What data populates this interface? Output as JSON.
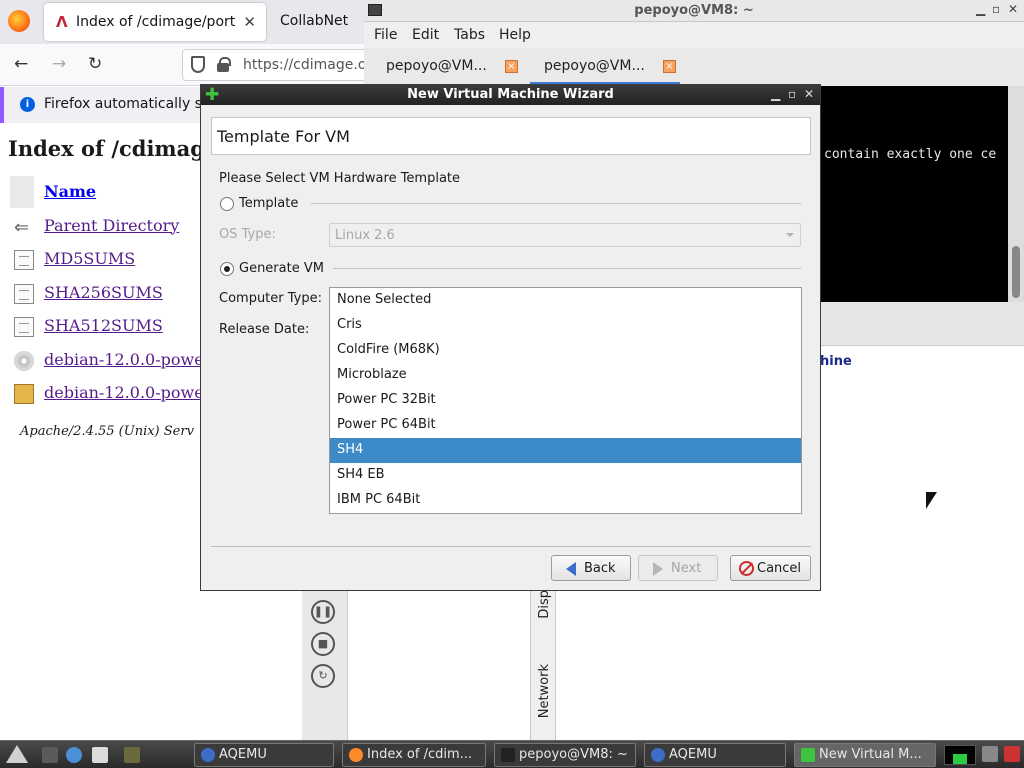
{
  "firefox": {
    "tabs": [
      {
        "label": "Index of /cdimage/ports/",
        "active": true
      },
      {
        "label": "CollabNet",
        "active": false
      }
    ],
    "url": "https://cdimage.o",
    "notice": "Firefox automatically se",
    "page_title": "Index of /cdimag",
    "listing": {
      "header": "Name",
      "rows": [
        {
          "icon": "back-icon",
          "label": "Parent Directory"
        },
        {
          "icon": "file-icon",
          "label": "MD5SUMS"
        },
        {
          "icon": "file-icon",
          "label": "SHA256SUMS"
        },
        {
          "icon": "file-icon",
          "label": "SHA512SUMS"
        },
        {
          "icon": "disc-icon",
          "label": "debian-12.0.0-powe"
        },
        {
          "icon": "package-icon",
          "label": "debian-12.0.0-powe"
        }
      ]
    },
    "server_signature": "Apache/2.4.55 (Unix) Serv"
  },
  "terminal": {
    "title": "pepoyo@VM8: ~",
    "menu": [
      "File",
      "Edit",
      "Tabs",
      "Help"
    ],
    "tabs": [
      "pepoyo@VM...",
      "pepoyo@VM..."
    ],
    "output_line": "contain exactly one ce"
  },
  "aqemu": {
    "hint": "hine",
    "side_tabs": [
      "Disp",
      "Network"
    ]
  },
  "dialog": {
    "title": "New Virtual Machine Wizard",
    "header": "Template For VM",
    "prompt": "Please Select VM Hardware Template",
    "template_radio": "Template",
    "os_type_label": "OS Type:",
    "os_type_value": "Linux 2.6",
    "generate_radio": "Generate VM",
    "computer_type_label": "Computer Type:",
    "release_date_label": "Release Date:",
    "computer_types": [
      "None Selected",
      "Cris",
      "ColdFire (M68K)",
      "Microblaze",
      "Power PC 32Bit",
      "Power PC 64Bit",
      "SH4",
      "SH4 EB",
      "IBM PC 64Bit"
    ],
    "selected_type": "SH4",
    "buttons": {
      "back": "Back",
      "next": "Next",
      "cancel": "Cancel"
    }
  },
  "taskbar": {
    "tasks": [
      {
        "label": "AQEMU",
        "icon": "aqemu-icon"
      },
      {
        "label": "Index of /cdim...",
        "icon": "firefox-icon"
      },
      {
        "label": "pepoyo@VM8: ~",
        "icon": "terminal-icon"
      },
      {
        "label": "AQEMU",
        "icon": "aqemu-icon"
      },
      {
        "label": "New Virtual M...",
        "icon": "plus-icon"
      }
    ]
  },
  "colors": {
    "selection": "#3d8ac9",
    "dialog_title_bg": "#2a2a2a",
    "link_visited": "#551a8b"
  }
}
